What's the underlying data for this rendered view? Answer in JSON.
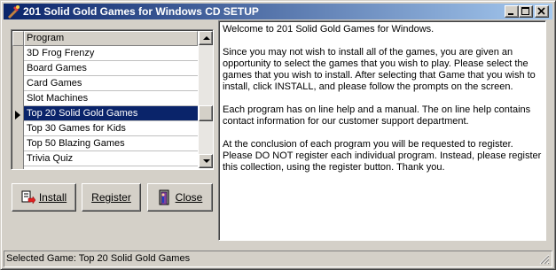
{
  "window": {
    "title": "201 Solid Gold Games for Windows CD SETUP"
  },
  "title_buttons": [
    "minimize",
    "maximize",
    "close"
  ],
  "program_list": {
    "header": "Program",
    "items": [
      "3D Frog Frenzy",
      "Board Games",
      "Card Games",
      "Slot Machines",
      "Top 20 Solid Gold Games",
      "Top 30 Games for Kids",
      "Top 50 Blazing Games",
      "Trivia Quiz"
    ],
    "selected_index": 4
  },
  "buttons": {
    "install": "Install",
    "register": "Register",
    "close": "Close"
  },
  "info_text": {
    "p1": "Welcome to 201 Solid Gold Games for Windows.",
    "p2": "Since you may not wish to install all of the games, you are given an opportunity to select the games that you wish to play. Please select the games that you wish to install. After selecting that Game that you wish to install, click INSTALL, and please follow the prompts on the screen.",
    "p3": "Each program has on line help and a manual. The on line help contains contact information for our customer support department.",
    "p4": "At the conclusion of each program you will be requested to register. Please DO NOT register each individual program. Instead, please register this collection, using the register button. Thank you."
  },
  "status": {
    "text": "Selected Game: Top 20 Solid Gold Games"
  },
  "colors": {
    "title_bar_start": "#0a246a",
    "title_bar_end": "#a6caf0",
    "selection": "#0a246a",
    "face": "#d4d0c8"
  }
}
